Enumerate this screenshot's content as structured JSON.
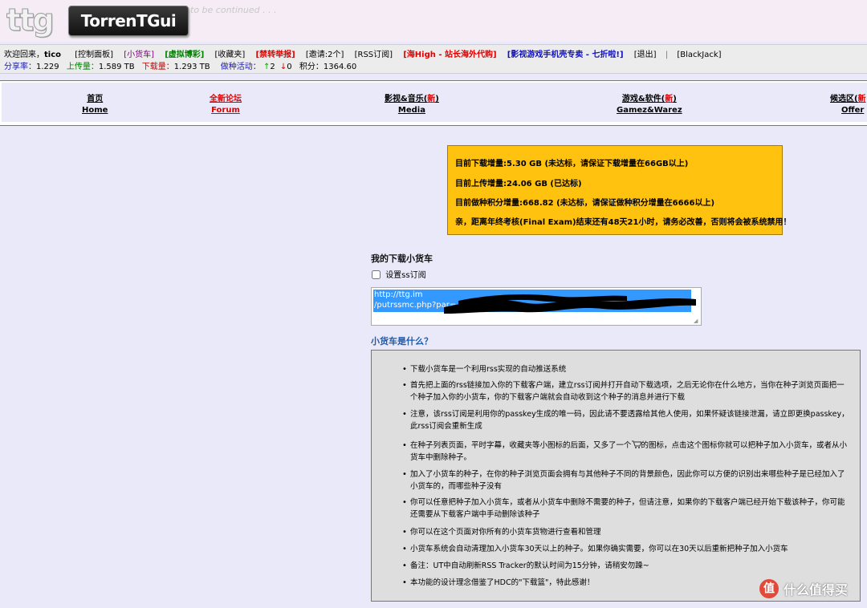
{
  "header": {
    "logo_mark": "ttg",
    "logo_text": "TorrenTGui",
    "tagline": "to be continued . . ."
  },
  "infobar": {
    "welcome": "欢迎回来，",
    "username": "tico",
    "links": [
      {
        "label": "[控制面板]",
        "color": "#000000"
      },
      {
        "label": "[小货车]",
        "color": "#800080"
      },
      {
        "label": "[虚拟博彩]",
        "color": "#008000"
      },
      {
        "label": "[收藏夹]",
        "color": "#000000"
      },
      {
        "label": "[禁转举报]",
        "color": "#e00000"
      },
      {
        "label": "[邀请:2个]",
        "color": "#000000"
      },
      {
        "label": "[RSS订阅]",
        "color": "#000000"
      },
      {
        "label": "[海High - 站长海外代购]",
        "color": "#e00000"
      },
      {
        "label": "[影视游戏手机壳专卖 - 七折啦!]",
        "color": "#1010c0"
      },
      {
        "label": "[退出]",
        "color": "#000000"
      }
    ],
    "separator": "|",
    "blackjack": "[BlackJack]",
    "ratio_label": "分享率：",
    "ratio": "1.229",
    "upload_label": "上传量：",
    "upload": "1.589 TB",
    "download_label": "下载量：",
    "download": "1.293 TB",
    "seeding_label": "做种活动：",
    "seeding_up": "2",
    "seeding_down": "0",
    "points_label": "积分：",
    "points": "1364.60"
  },
  "nav": [
    {
      "cn": "首页",
      "en": "Home"
    },
    {
      "cn": "全新论坛",
      "en": "Forum"
    },
    {
      "cn": "影视&音乐(",
      "new": "新",
      "close": ")",
      "en": "Media"
    },
    {
      "cn": "游戏&软件(",
      "new": "新",
      "close": ")",
      "en": "Gamez&Warez"
    },
    {
      "cn": "候选区(",
      "new": "新",
      "en": "Offer"
    }
  ],
  "warning": {
    "line1": "目前下载增量:5.30 GB (未达标，请保证下载增量在66GB以上)",
    "line2": "目前上传增量:24.06 GB (已达标)",
    "line3": "目前做种积分增量:668.82 (未达标，请保证做种积分增量在6666以上)",
    "line4": "亲，距离年终考核(Final Exam)结束还有48天21小时，请务必改善，否则将会被系统禁用！"
  },
  "cart": {
    "title": "我的下载小货车",
    "checkbox_label": "设置ss订阅",
    "rss_line1": "http://ttg.im",
    "rss_line2": "/putrssmc.php?par="
  },
  "what": {
    "title": "小货车是什么？",
    "items": [
      "下载小货车是一个利用rss实现的自动推送系统",
      "首先把上面的rss链接加入你的下载客户端，建立rss订阅并打开自动下载选项，之后无论你在什么地方，当你在种子浏览页面把一个种子加入你的小货车，你的下载客户端就会自动收到这个种子的消息并进行下载",
      "注意，该rss订阅是利用你的passkey生成的唯一码，因此请不要透露给其他人使用，如果怀疑该链接泄漏，请立即更换passkey，此rss订阅会重新生成",
      "在种子列表页面，平时字幕，收藏夹等小图标的后面，又多了一个",
      "的图标，点击这个图标你就可以把种子加入小货车，或者从小货车中删除种子。",
      "加入了小货车的种子，在你的种子浏览页面会拥有与其他种子不同的背景颜色，因此你可以方便的识别出来哪些种子是已经加入了小货车的，而哪些种子没有",
      "你可以任意把种子加入小货车，或者从小货车中删除不需要的种子，但请注意，如果你的下载客户端已经开始下载该种子，你可能还需要从下载客户端中手动删除该种子",
      "你可以在这个页面对你所有的小货车货物进行查看和管理",
      "小货车系统会自动清理加入小货车30天以上的种子。如果你确实需要，你可以在30天以后重新把种子加入小货车",
      "备注：UT中自动刷新RSS Tracker的默认时间为15分钟，请稍安勿躁~",
      "本功能的设计理念借鉴了HDC的\"下载篮\"，特此感谢！"
    ]
  },
  "watermark": {
    "badge": "值",
    "text": "什么值得买"
  }
}
